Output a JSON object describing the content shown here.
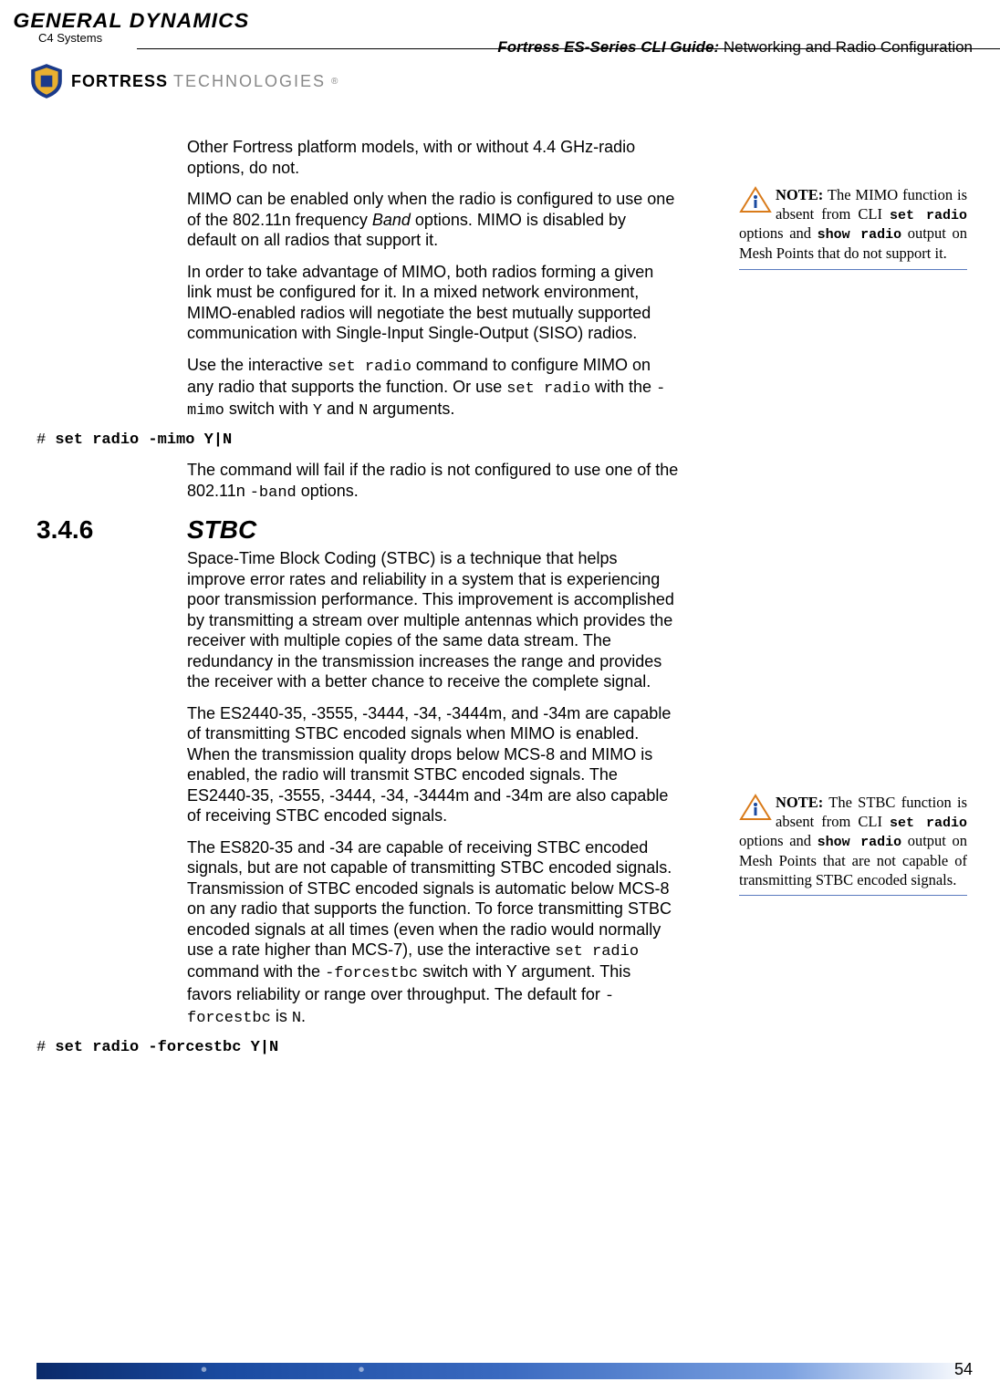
{
  "header": {
    "gd": "GENERAL DYNAMICS",
    "c4": "C4 Systems",
    "guide_bold": "Fortress ES-Series CLI Guide:",
    "guide_rest": " Networking and Radio Configuration",
    "fortress": "FORTRESS",
    "tech": "TECHNOLOGIES",
    "reg": "®"
  },
  "p1": "Other Fortress platform models, with or without 4.4 GHz-radio options, do not.",
  "p2a": "MIMO can be enabled only when the radio is configured to use one of the 802.11n frequency ",
  "p2b": "Band",
  "p2c": " options. MIMO is disabled by default on all radios that support it.",
  "p3": "In order to take advantage of MIMO, both radios forming a given link must be configured for it. In a mixed network environment, MIMO-enabled radios will negotiate the best mutually supported communication with Single-Input Single-Output (SISO) radios.",
  "p4a": "Use the interactive ",
  "p4b": "set radio",
  "p4c": " command to configure MIMO on any radio that supports the function. Or use ",
  "p4d": "set radio",
  "p4e": " with the ",
  "p4f": "-mimo",
  "p4g": " switch with ",
  "p4h": "Y",
  "p4i": " and ",
  "p4j": "N",
  "p4k": " arguments.",
  "cmd1_prompt": "# ",
  "cmd1": "set radio -mimo Y|N",
  "p5a": "The command will fail if the radio is not configured to use one of the 802.11n ",
  "p5b": "-band",
  "p5c": " options.",
  "sec_num": "3.4.6",
  "sec_title": "STBC",
  "p6": "Space-Time Block Coding (STBC) is a technique that helps improve error rates and reliability in a system that is experiencing poor transmission performance. This improvement is accomplished by transmitting a stream over multiple antennas which provides the receiver with multiple copies of the same data stream. The redundancy in the transmission increases the range and provides the receiver with a better chance to receive the complete signal.",
  "p7": "The ES2440-35, -3555, -3444, -34, -3444m, and -34m are capable of transmitting STBC encoded signals when MIMO is enabled. When the transmission quality drops below MCS-8 and MIMO is enabled, the radio will transmit STBC encoded signals. The ES2440-35, -3555, -3444, -34, -3444m and -34m are also capable of receiving STBC encoded signals.",
  "p8a": "The ES820-35 and -34 are capable of receiving STBC encoded signals, but are not capable of transmitting STBC encoded signals. Transmission of STBC encoded signals is automatic below MCS-8 on any radio that supports the function. To force transmitting STBC encoded signals at all times (even when the radio would normally use a rate higher than MCS-7), use the interactive ",
  "p8b": "set radio",
  "p8c": " command with the ",
  "p8d": "-forcestbc",
  "p8e": " switch with Y argument. This favors reliability or range over throughput. The default for ",
  "p8f": "-forcestbc",
  "p8g": " is ",
  "p8h": "N",
  "p8i": ".",
  "cmd2_prompt": "# ",
  "cmd2": "set radio -forcestbc Y|N",
  "note1": {
    "label": "NOTE:",
    "t1": " The MIMO function is absent from CLI ",
    "c1": "set radio",
    "t2": " options and ",
    "c2": "show radio",
    "t3": " output on Mesh Points that do not support it."
  },
  "note2": {
    "label": "NOTE:",
    "t1": " The STBC function is absent from CLI ",
    "c1": "set radio",
    "t2": " options and ",
    "c2": "show radio",
    "t3": " output on Mesh Points that are not capable of transmitting STBC encoded signals."
  },
  "page": "54"
}
